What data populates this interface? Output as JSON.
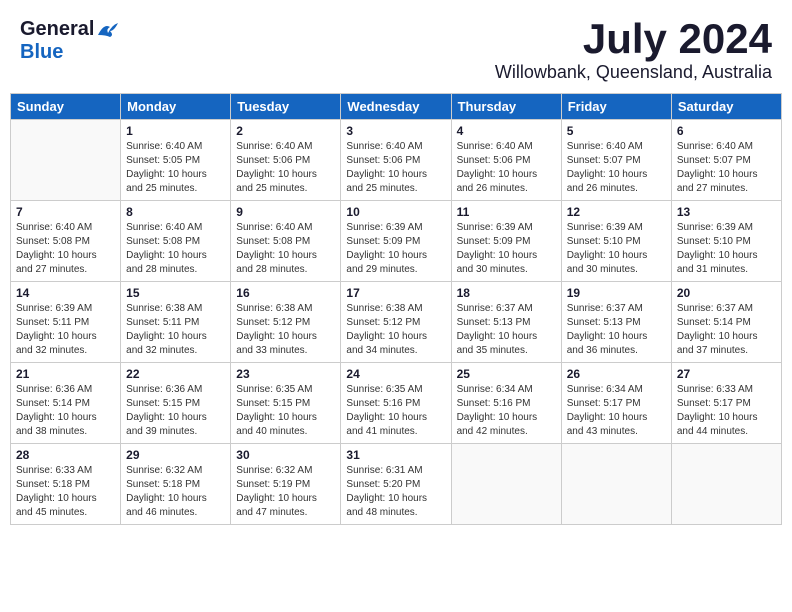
{
  "header": {
    "logo_general": "General",
    "logo_blue": "Blue",
    "month": "July 2024",
    "location": "Willowbank, Queensland, Australia"
  },
  "calendar": {
    "weekdays": [
      "Sunday",
      "Monday",
      "Tuesday",
      "Wednesday",
      "Thursday",
      "Friday",
      "Saturday"
    ],
    "weeks": [
      [
        {
          "day": "",
          "info": ""
        },
        {
          "day": "1",
          "info": "Sunrise: 6:40 AM\nSunset: 5:05 PM\nDaylight: 10 hours\nand 25 minutes."
        },
        {
          "day": "2",
          "info": "Sunrise: 6:40 AM\nSunset: 5:06 PM\nDaylight: 10 hours\nand 25 minutes."
        },
        {
          "day": "3",
          "info": "Sunrise: 6:40 AM\nSunset: 5:06 PM\nDaylight: 10 hours\nand 25 minutes."
        },
        {
          "day": "4",
          "info": "Sunrise: 6:40 AM\nSunset: 5:06 PM\nDaylight: 10 hours\nand 26 minutes."
        },
        {
          "day": "5",
          "info": "Sunrise: 6:40 AM\nSunset: 5:07 PM\nDaylight: 10 hours\nand 26 minutes."
        },
        {
          "day": "6",
          "info": "Sunrise: 6:40 AM\nSunset: 5:07 PM\nDaylight: 10 hours\nand 27 minutes."
        }
      ],
      [
        {
          "day": "7",
          "info": "Sunrise: 6:40 AM\nSunset: 5:08 PM\nDaylight: 10 hours\nand 27 minutes."
        },
        {
          "day": "8",
          "info": "Sunrise: 6:40 AM\nSunset: 5:08 PM\nDaylight: 10 hours\nand 28 minutes."
        },
        {
          "day": "9",
          "info": "Sunrise: 6:40 AM\nSunset: 5:08 PM\nDaylight: 10 hours\nand 28 minutes."
        },
        {
          "day": "10",
          "info": "Sunrise: 6:39 AM\nSunset: 5:09 PM\nDaylight: 10 hours\nand 29 minutes."
        },
        {
          "day": "11",
          "info": "Sunrise: 6:39 AM\nSunset: 5:09 PM\nDaylight: 10 hours\nand 30 minutes."
        },
        {
          "day": "12",
          "info": "Sunrise: 6:39 AM\nSunset: 5:10 PM\nDaylight: 10 hours\nand 30 minutes."
        },
        {
          "day": "13",
          "info": "Sunrise: 6:39 AM\nSunset: 5:10 PM\nDaylight: 10 hours\nand 31 minutes."
        }
      ],
      [
        {
          "day": "14",
          "info": "Sunrise: 6:39 AM\nSunset: 5:11 PM\nDaylight: 10 hours\nand 32 minutes."
        },
        {
          "day": "15",
          "info": "Sunrise: 6:38 AM\nSunset: 5:11 PM\nDaylight: 10 hours\nand 32 minutes."
        },
        {
          "day": "16",
          "info": "Sunrise: 6:38 AM\nSunset: 5:12 PM\nDaylight: 10 hours\nand 33 minutes."
        },
        {
          "day": "17",
          "info": "Sunrise: 6:38 AM\nSunset: 5:12 PM\nDaylight: 10 hours\nand 34 minutes."
        },
        {
          "day": "18",
          "info": "Sunrise: 6:37 AM\nSunset: 5:13 PM\nDaylight: 10 hours\nand 35 minutes."
        },
        {
          "day": "19",
          "info": "Sunrise: 6:37 AM\nSunset: 5:13 PM\nDaylight: 10 hours\nand 36 minutes."
        },
        {
          "day": "20",
          "info": "Sunrise: 6:37 AM\nSunset: 5:14 PM\nDaylight: 10 hours\nand 37 minutes."
        }
      ],
      [
        {
          "day": "21",
          "info": "Sunrise: 6:36 AM\nSunset: 5:14 PM\nDaylight: 10 hours\nand 38 minutes."
        },
        {
          "day": "22",
          "info": "Sunrise: 6:36 AM\nSunset: 5:15 PM\nDaylight: 10 hours\nand 39 minutes."
        },
        {
          "day": "23",
          "info": "Sunrise: 6:35 AM\nSunset: 5:15 PM\nDaylight: 10 hours\nand 40 minutes."
        },
        {
          "day": "24",
          "info": "Sunrise: 6:35 AM\nSunset: 5:16 PM\nDaylight: 10 hours\nand 41 minutes."
        },
        {
          "day": "25",
          "info": "Sunrise: 6:34 AM\nSunset: 5:16 PM\nDaylight: 10 hours\nand 42 minutes."
        },
        {
          "day": "26",
          "info": "Sunrise: 6:34 AM\nSunset: 5:17 PM\nDaylight: 10 hours\nand 43 minutes."
        },
        {
          "day": "27",
          "info": "Sunrise: 6:33 AM\nSunset: 5:17 PM\nDaylight: 10 hours\nand 44 minutes."
        }
      ],
      [
        {
          "day": "28",
          "info": "Sunrise: 6:33 AM\nSunset: 5:18 PM\nDaylight: 10 hours\nand 45 minutes."
        },
        {
          "day": "29",
          "info": "Sunrise: 6:32 AM\nSunset: 5:18 PM\nDaylight: 10 hours\nand 46 minutes."
        },
        {
          "day": "30",
          "info": "Sunrise: 6:32 AM\nSunset: 5:19 PM\nDaylight: 10 hours\nand 47 minutes."
        },
        {
          "day": "31",
          "info": "Sunrise: 6:31 AM\nSunset: 5:20 PM\nDaylight: 10 hours\nand 48 minutes."
        },
        {
          "day": "",
          "info": ""
        },
        {
          "day": "",
          "info": ""
        },
        {
          "day": "",
          "info": ""
        }
      ]
    ]
  }
}
